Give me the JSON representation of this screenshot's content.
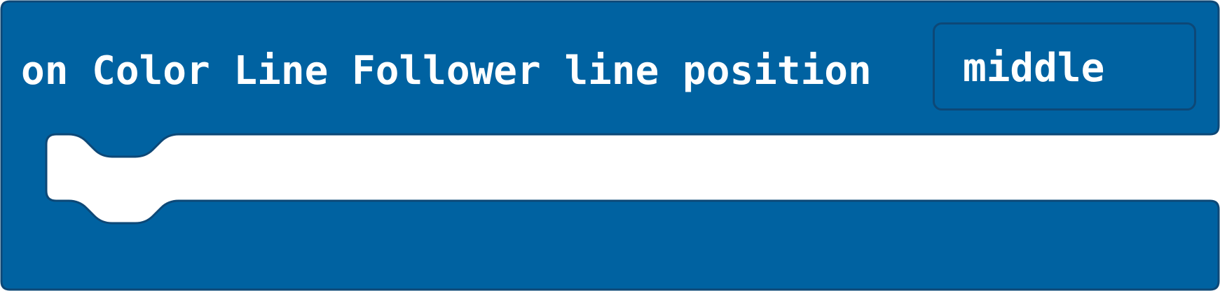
{
  "block": {
    "label": "on Color Line Follower line position",
    "dropdown_value": "middle",
    "fill_color": "#0062a1",
    "stroke_color": "#0d4877"
  }
}
